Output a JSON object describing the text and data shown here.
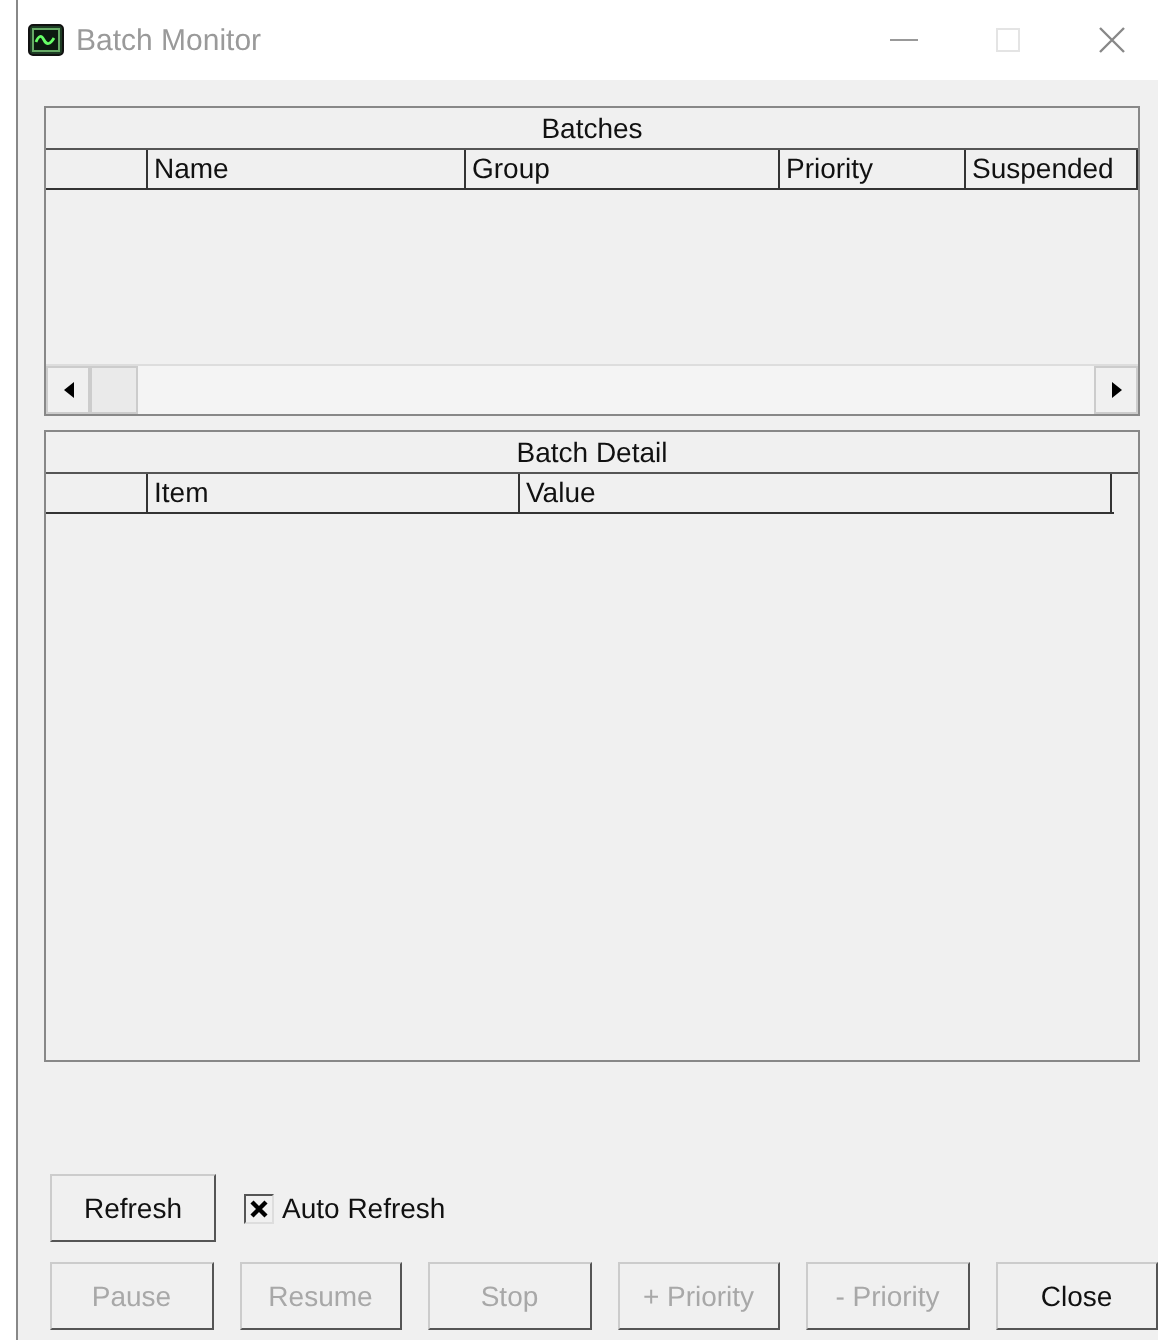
{
  "window": {
    "title": "Batch Monitor"
  },
  "batches": {
    "title": "Batches",
    "columns": [
      "Name",
      "Group",
      "Priority",
      "Suspended"
    ]
  },
  "batch_detail": {
    "title": "Batch Detail",
    "columns": [
      "Item",
      "Value"
    ]
  },
  "refresh_button": {
    "label": "Refresh",
    "disabled": false
  },
  "auto_refresh": {
    "label": "Auto Refresh",
    "checked": true
  },
  "buttons": [
    {
      "label": "Pause",
      "disabled": true
    },
    {
      "label": "Resume",
      "disabled": true
    },
    {
      "label": "Stop",
      "disabled": true
    },
    {
      "label": "+ Priority",
      "disabled": true
    },
    {
      "label": "- Priority",
      "disabled": true
    },
    {
      "label": "Close",
      "disabled": false
    }
  ]
}
